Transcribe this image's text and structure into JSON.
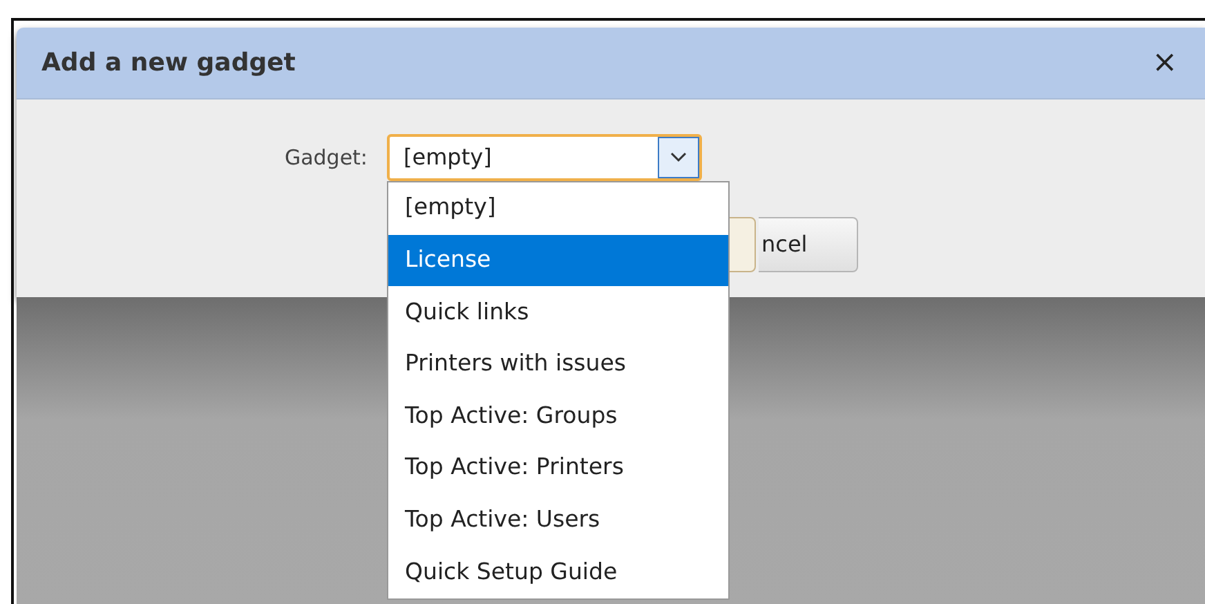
{
  "dialog": {
    "title": "Add a new gadget",
    "close": "×"
  },
  "field": {
    "label": "Gadget:",
    "value": "[empty]",
    "expanded": true
  },
  "dropdown": {
    "items": [
      {
        "label": "[empty]",
        "selected": false
      },
      {
        "label": "License",
        "selected": true
      },
      {
        "label": "Quick links",
        "selected": false
      },
      {
        "label": "Printers with issues",
        "selected": false
      },
      {
        "label": "Top Active: Groups",
        "selected": false
      },
      {
        "label": "Top Active: Printers",
        "selected": false
      },
      {
        "label": "Top Active: Users",
        "selected": false
      },
      {
        "label": "Quick Setup Guide",
        "selected": false
      }
    ]
  },
  "buttons": [
    {
      "kind": "hidden"
    },
    {
      "kind": "text",
      "label": "ncel"
    }
  ]
}
